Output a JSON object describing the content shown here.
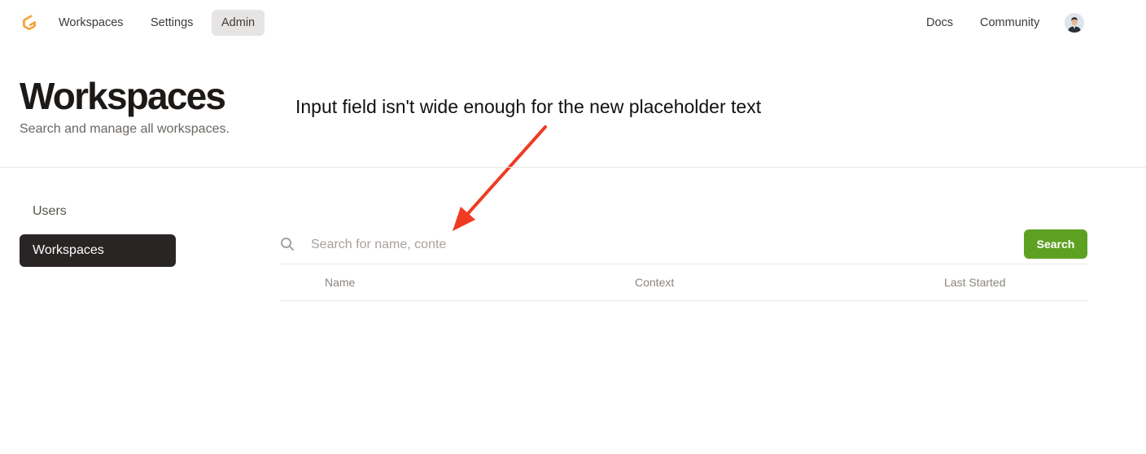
{
  "nav": {
    "items": [
      "Workspaces",
      "Settings",
      "Admin"
    ],
    "active": "Admin",
    "right_items": [
      "Docs",
      "Community"
    ]
  },
  "header": {
    "title": "Workspaces",
    "subtitle": "Search and manage all workspaces."
  },
  "annotation": {
    "text": "Input field isn't wide enough for the new placeholder text",
    "color": "#ef3b24"
  },
  "sidebar": {
    "items": [
      {
        "label": "Users",
        "active": false
      },
      {
        "label": "Workspaces",
        "active": true
      }
    ]
  },
  "search": {
    "placeholder": "Search for name, conte",
    "value": "",
    "button_label": "Search",
    "button_color": "#5ea122"
  },
  "table": {
    "columns": [
      "Name",
      "Context",
      "Last Started"
    ]
  },
  "colors": {
    "logo": "#f5a33d",
    "active_sidebar_bg": "#292524"
  }
}
